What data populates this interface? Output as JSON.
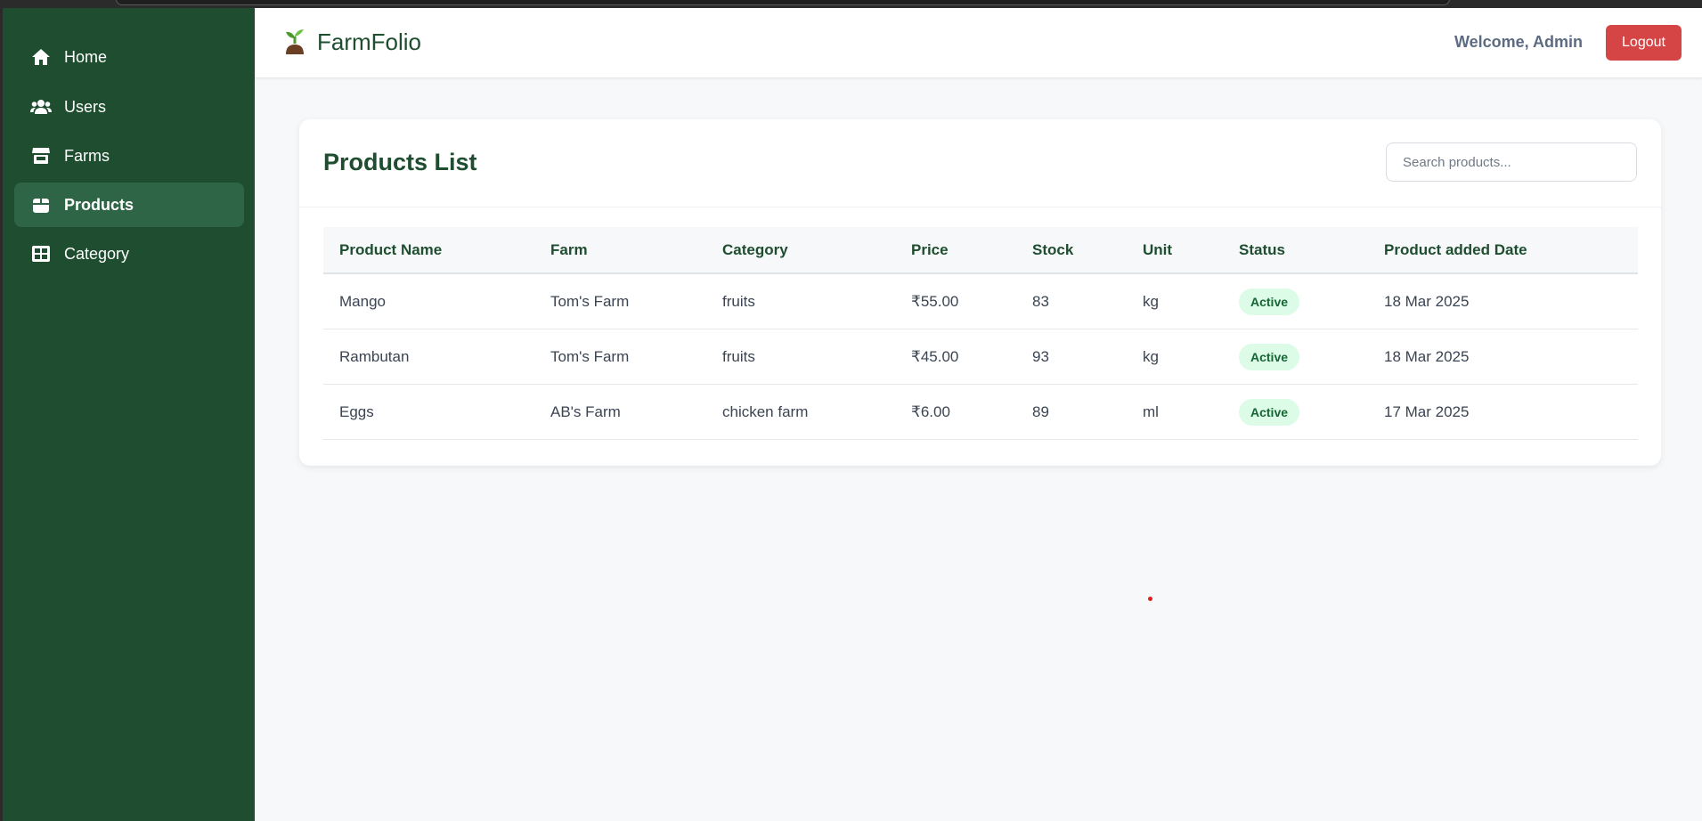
{
  "app": {
    "name": "FarmFolio",
    "welcome_text": "Welcome, Admin",
    "logout_label": "Logout"
  },
  "sidebar": {
    "items": [
      {
        "label": "Home",
        "icon": "home-icon",
        "active": false
      },
      {
        "label": "Users",
        "icon": "users-icon",
        "active": false
      },
      {
        "label": "Farms",
        "icon": "store-icon",
        "active": false
      },
      {
        "label": "Products",
        "icon": "box-icon",
        "active": true
      },
      {
        "label": "Category",
        "icon": "grid-icon",
        "active": false
      }
    ]
  },
  "products": {
    "title": "Products List",
    "search_placeholder": "Search products...",
    "columns": [
      "Product Name",
      "Farm",
      "Category",
      "Price",
      "Stock",
      "Unit",
      "Status",
      "Product added Date"
    ],
    "rows": [
      {
        "name": "Mango",
        "farm": "Tom's Farm",
        "category": "fruits",
        "price": "₹55.00",
        "stock": "83",
        "unit": "kg",
        "status": "Active",
        "date": "18 Mar 2025"
      },
      {
        "name": "Rambutan",
        "farm": "Tom's Farm",
        "category": "fruits",
        "price": "₹45.00",
        "stock": "93",
        "unit": "kg",
        "status": "Active",
        "date": "18 Mar 2025"
      },
      {
        "name": "Eggs",
        "farm": "AB's Farm",
        "category": "chicken farm",
        "price": "₹6.00",
        "stock": "89",
        "unit": "ml",
        "status": "Active",
        "date": "17 Mar 2025"
      }
    ]
  },
  "colors": {
    "sidebar_bg": "#1e4d2f",
    "sidebar_active": "#2e6547",
    "logout_bg": "#d64545",
    "status_bg": "#dcfce7",
    "status_text": "#166534"
  }
}
